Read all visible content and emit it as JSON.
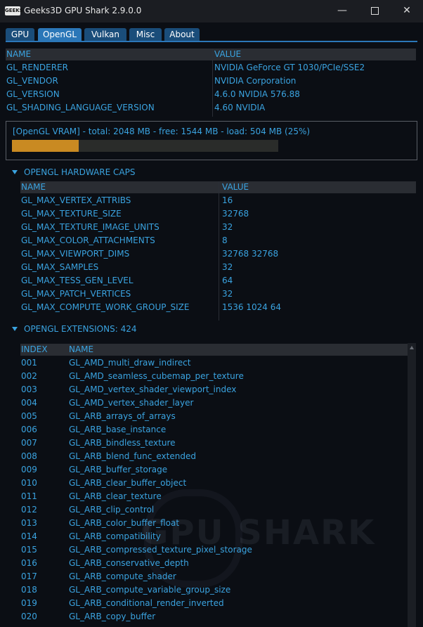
{
  "window": {
    "title": "Geeks3D GPU Shark 2.9.0.0",
    "icon_label": "GEEKS"
  },
  "tabs": [
    {
      "label": "GPU"
    },
    {
      "label": "OpenGL"
    },
    {
      "label": "Vulkan"
    },
    {
      "label": "Misc"
    },
    {
      "label": "About"
    }
  ],
  "active_tab": "OpenGL",
  "info_table": {
    "headers": [
      "NAME",
      "VALUE"
    ],
    "rows": [
      {
        "name": "GL_RENDERER",
        "value": "NVIDIA GeForce GT 1030/PCIe/SSE2"
      },
      {
        "name": "GL_VENDOR",
        "value": "NVIDIA Corporation"
      },
      {
        "name": "GL_VERSION",
        "value": "4.6.0 NVIDIA 576.88"
      },
      {
        "name": "GL_SHADING_LANGUAGE_VERSION",
        "value": "4.60 NVIDIA"
      }
    ]
  },
  "vram": {
    "text": "[OpenGL VRAM]  - total: 2048 MB  - free: 1544 MB  - load: 504 MB (25%)",
    "load_fraction": 0.25,
    "bar_color": "#c98a22"
  },
  "caps": {
    "title": "OPENGL HARDWARE CAPS",
    "headers": [
      "NAME",
      "VALUE"
    ],
    "rows": [
      {
        "name": "GL_MAX_VERTEX_ATTRIBS",
        "value": "16"
      },
      {
        "name": "GL_MAX_TEXTURE_SIZE",
        "value": "32768"
      },
      {
        "name": "GL_MAX_TEXTURE_IMAGE_UNITS",
        "value": "32"
      },
      {
        "name": "GL_MAX_COLOR_ATTACHMENTS",
        "value": "8"
      },
      {
        "name": "GL_MAX_VIEWPORT_DIMS",
        "value": "32768 32768"
      },
      {
        "name": "GL_MAX_SAMPLES",
        "value": "32"
      },
      {
        "name": "GL_MAX_TESS_GEN_LEVEL",
        "value": "64"
      },
      {
        "name": "GL_MAX_PATCH_VERTICES",
        "value": "32"
      },
      {
        "name": "GL_MAX_COMPUTE_WORK_GROUP_SIZE",
        "value": "1536 1024 64"
      }
    ]
  },
  "extensions": {
    "title": "OPENGL EXTENSIONS: 424",
    "headers": [
      "INDEX",
      "NAME"
    ],
    "rows": [
      {
        "index": "001",
        "name": "GL_AMD_multi_draw_indirect"
      },
      {
        "index": "002",
        "name": "GL_AMD_seamless_cubemap_per_texture"
      },
      {
        "index": "003",
        "name": "GL_AMD_vertex_shader_viewport_index"
      },
      {
        "index": "004",
        "name": "GL_AMD_vertex_shader_layer"
      },
      {
        "index": "005",
        "name": "GL_ARB_arrays_of_arrays"
      },
      {
        "index": "006",
        "name": "GL_ARB_base_instance"
      },
      {
        "index": "007",
        "name": "GL_ARB_bindless_texture"
      },
      {
        "index": "008",
        "name": "GL_ARB_blend_func_extended"
      },
      {
        "index": "009",
        "name": "GL_ARB_buffer_storage"
      },
      {
        "index": "010",
        "name": "GL_ARB_clear_buffer_object"
      },
      {
        "index": "011",
        "name": "GL_ARB_clear_texture"
      },
      {
        "index": "012",
        "name": "GL_ARB_clip_control"
      },
      {
        "index": "013",
        "name": "GL_ARB_color_buffer_float"
      },
      {
        "index": "014",
        "name": "GL_ARB_compatibility"
      },
      {
        "index": "015",
        "name": "GL_ARB_compressed_texture_pixel_storage"
      },
      {
        "index": "016",
        "name": "GL_ARB_conservative_depth"
      },
      {
        "index": "017",
        "name": "GL_ARB_compute_shader"
      },
      {
        "index": "018",
        "name": "GL_ARB_compute_variable_group_size"
      },
      {
        "index": "019",
        "name": "GL_ARB_conditional_render_inverted"
      },
      {
        "index": "020",
        "name": "GL_ARB_copy_buffer"
      }
    ]
  },
  "watermark": "GPU SHARK"
}
